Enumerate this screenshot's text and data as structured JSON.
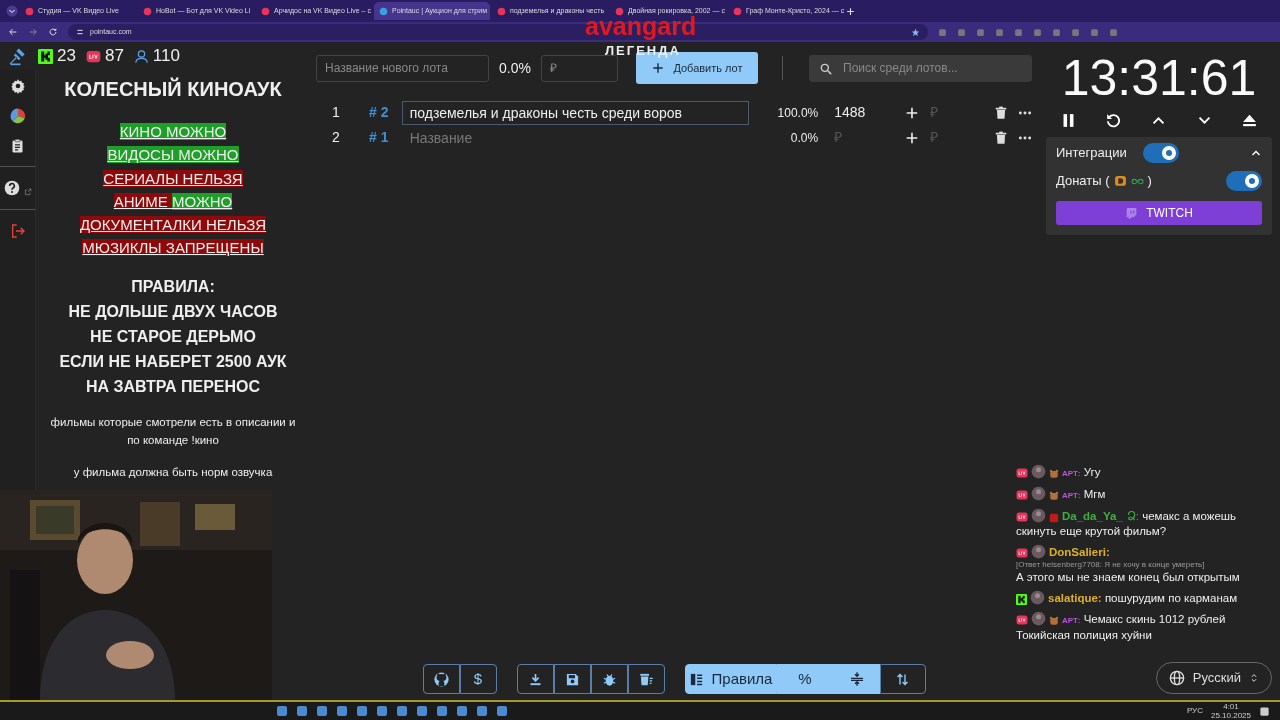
{
  "browser": {
    "tabs": [
      {
        "title": "Студия — VK Видео Live",
        "selected": false
      },
      {
        "title": "HoBot — Бот для VK Video Li",
        "selected": false
      },
      {
        "title": "Арчидос на VK Видео Live – с",
        "selected": false
      },
      {
        "title": "Pointauc | Аукцион для стрим",
        "selected": true
      },
      {
        "title": "подземелья и драконы честь",
        "selected": false
      },
      {
        "title": "Двойная рокировка, 2002 — с",
        "selected": false
      },
      {
        "title": "Граф Монте-Кристо, 2024 — с",
        "selected": false
      }
    ],
    "address": "pointauc.com"
  },
  "overlay": {
    "logo": "avangard",
    "caption": "ЛЕГЕНДА"
  },
  "stats": [
    {
      "kind": "kick",
      "value": "23"
    },
    {
      "kind": "live",
      "value": "87"
    },
    {
      "kind": "viewers",
      "value": "110"
    }
  ],
  "rules": {
    "title": "КОЛЕСНЫЙ КИНОАУК",
    "tags": [
      {
        "segments": [
          {
            "text": "КИНО МОЖНО",
            "color": "#1f9e2a"
          }
        ]
      },
      {
        "segments": [
          {
            "text": "ВИДОСЫ МОЖНО",
            "color": "#1f9e2a"
          }
        ]
      },
      {
        "segments": [
          {
            "text": "СЕРИАЛЫ НЕЛЬЗЯ",
            "color": "#8e0a0a"
          }
        ]
      },
      {
        "segments": [
          {
            "text": "АНИМЕ ",
            "color": "#8e0a0a"
          },
          {
            "text": "МОЖНО",
            "color": "#1f9e2a"
          }
        ]
      },
      {
        "segments": [
          {
            "text": "ДОКУМЕНТАЛКИ НЕЛЬЗЯ",
            "color": "#8e0a0a"
          }
        ]
      },
      {
        "segments": [
          {
            "text": "МЮЗИКЛЫ ЗАПРЕЩЕНЫ",
            "color": "#8e0a0a"
          }
        ]
      }
    ],
    "heading": "ПРАВИЛА:",
    "lines": [
      "НЕ ДОЛЬШЕ ДВУХ ЧАСОВ",
      "НЕ СТАРОЕ ДЕРЬМО",
      "ЕСЛИ НЕ НАБЕРЕТ 2500 АУК",
      "НА ЗАВТРА ПЕРЕНОС"
    ],
    "notes": [
      "фильмы которые смотрели есть в описании и по команде !кино",
      "у фильма должна быть норм озвучка"
    ]
  },
  "new_lot": {
    "placeholder": "Название нового лота",
    "percent": "0.0%",
    "amount_placeholder": "₽",
    "button": "Добавить лот"
  },
  "search": {
    "placeholder": "Поиск среди лотов..."
  },
  "lots": [
    {
      "index": "1",
      "id": "# 2",
      "name": "подземелья и драконы честь среди воров",
      "percent": "100.0%",
      "amount": "1488",
      "add_placeholder": "₽"
    },
    {
      "index": "2",
      "id": "# 1",
      "name_placeholder": "Название",
      "percent": "0.0%",
      "amount_placeholder": "₽",
      "add_placeholder": "₽"
    }
  ],
  "timer": "13:31:61",
  "integrations": {
    "label": "Интеграции",
    "on": true,
    "expanded": true,
    "donations": {
      "label": "Донаты (",
      "suffix": ")",
      "on": true
    },
    "twitch": "TWITCH"
  },
  "chat": [
    {
      "kind": "live",
      "badge": true,
      "user": "АРТ:",
      "color": "#c04ee8",
      "small_name": true,
      "text": "Угу"
    },
    {
      "kind": "live",
      "badge": true,
      "user": "АРТ:",
      "color": "#c04ee8",
      "small_name": true,
      "text": "Мгм"
    },
    {
      "kind": "live",
      "badge": true,
      "user": "Da_da_Ya_",
      "color": "#3fae3f",
      "small_name": false,
      "mark": "Ձ:",
      "text": "чемакс а можешь скинуть еще крутой фильм?"
    },
    {
      "kind": "live",
      "badge": false,
      "user": "DonSalieri:",
      "color": "#e0b02a",
      "small_name": false,
      "reply": "[Ответ heisenberg7708: Я не хочу в конце умереть]",
      "text": "А этого мы не знаем конец был открытым"
    },
    {
      "kind": "kick",
      "badge": false,
      "user": "salatique:",
      "color": "#e0b02a",
      "small_name": false,
      "text": "пошурудим по карманам"
    },
    {
      "kind": "live",
      "badge": true,
      "user": "АРТ:",
      "color": "#c04ee8",
      "small_name": true,
      "text": "Чемакс скинь 1012 рублей Токийская полиция хуйни"
    }
  ],
  "toolbar": {
    "dollar": "$",
    "rules": "Правила",
    "percent": "%",
    "language": "Русский"
  },
  "taskbar": {
    "lang": "РУС",
    "time": "4:01",
    "date": "25.10.2025"
  }
}
